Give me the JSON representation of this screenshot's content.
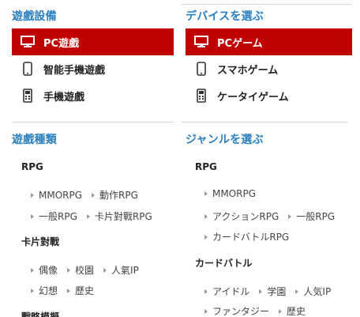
{
  "left": {
    "device_title": "遊戲設備",
    "devices": [
      {
        "label": "PC遊戲",
        "icon": "monitor-icon",
        "active": true
      },
      {
        "label": "智能手機遊戲",
        "icon": "smartphone-icon",
        "active": false
      },
      {
        "label": "手機遊戲",
        "icon": "feature-phone-icon",
        "active": false
      }
    ],
    "genre_title": "遊戲種類",
    "cat1": {
      "name": "RPG",
      "row1": [
        "MMORPG",
        "動作RPG"
      ],
      "row2": [
        "一般RPG",
        "卡片對戰RPG"
      ]
    },
    "cat2": {
      "name": "卡片對戰",
      "row1": [
        "偶像",
        "校園",
        "人氣IP"
      ],
      "row2": [
        "幻想",
        "歷史"
      ]
    },
    "cat3_partial": "戰略模擬"
  },
  "right": {
    "device_title": "デバイスを選ぶ",
    "devices": [
      {
        "label": "PCゲーム",
        "icon": "monitor-icon",
        "active": true
      },
      {
        "label": "スマホゲーム",
        "icon": "smartphone-icon",
        "active": false
      },
      {
        "label": "ケータイゲーム",
        "icon": "feature-phone-icon",
        "active": false
      }
    ],
    "genre_title": "ジャンルを選ぶ",
    "cat1": {
      "name": "RPG",
      "row1": [
        "MMORPG"
      ],
      "row2": [
        "アクションRPG",
        "一般RPG"
      ],
      "row3": [
        "カードバトルRPG"
      ]
    },
    "cat2": {
      "name": "カードバトル",
      "row1": [
        "アイドル",
        "学園",
        "人気IP"
      ],
      "row2": [
        "ファンタジー",
        "歴史"
      ]
    }
  },
  "colors": {
    "accent_blue": "#2a7fc0",
    "active_red": "#c00000"
  }
}
